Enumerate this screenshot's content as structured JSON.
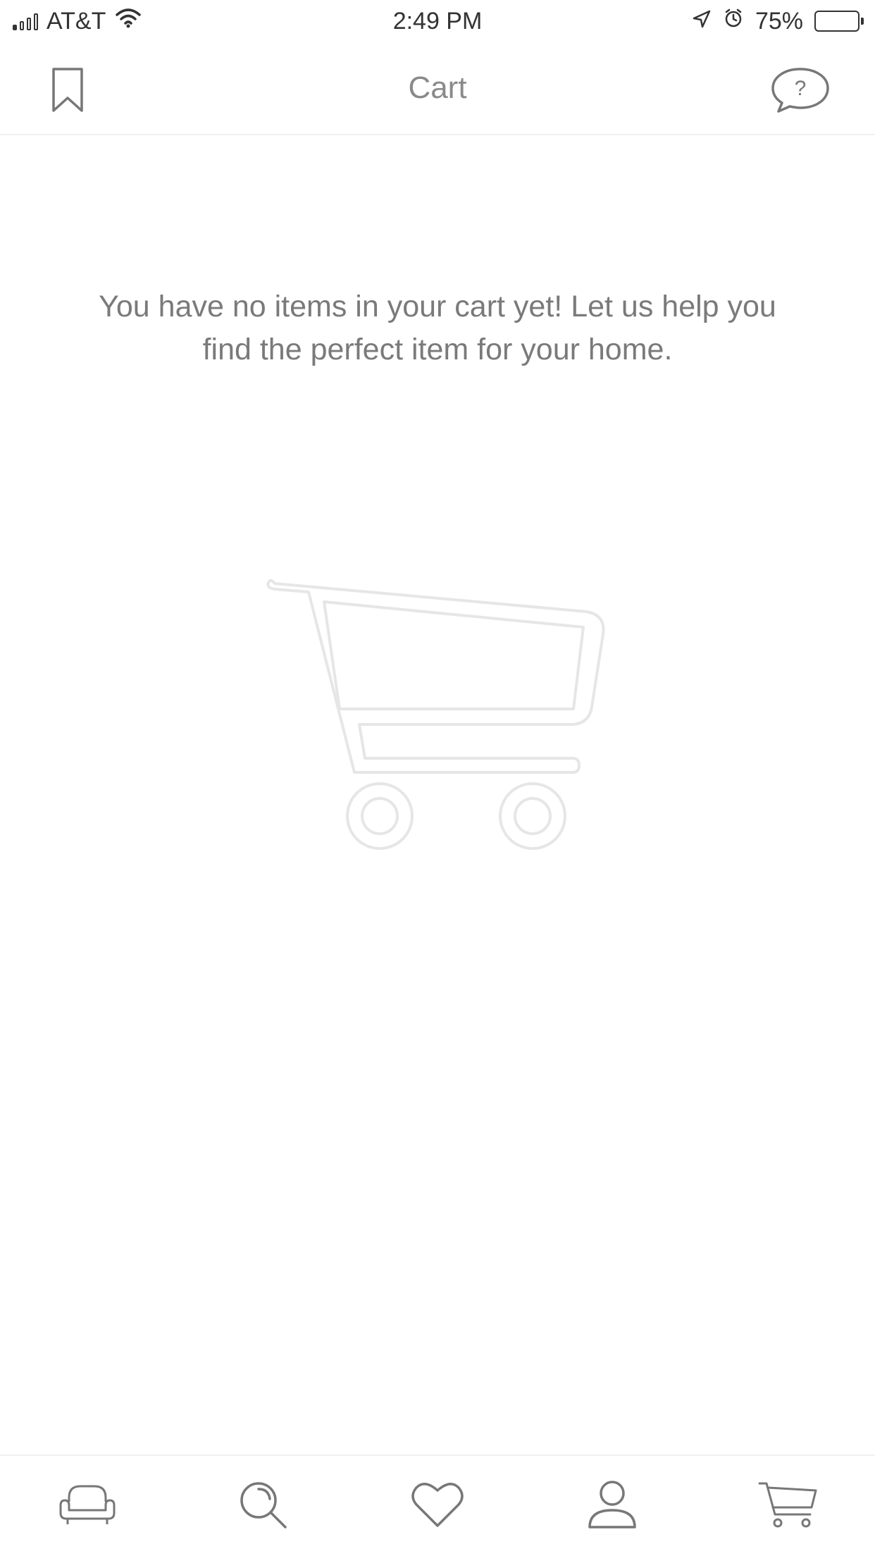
{
  "status_bar": {
    "carrier": "AT&T",
    "time": "2:49 PM",
    "battery_percent": "75%",
    "battery_level": 0.75,
    "icons": [
      "signal-icon",
      "wifi-icon",
      "location-icon",
      "alarm-icon",
      "battery-icon"
    ]
  },
  "header": {
    "title": "Cart",
    "left_icon": "bookmark-icon",
    "right_icon": "help-chat-icon",
    "help_glyph": "?"
  },
  "main": {
    "empty_message": "You have no items in your cart yet! Let us help you find the perfect item for your home.",
    "illustration": "cart-icon"
  },
  "tab_bar": {
    "tabs": [
      {
        "name": "home",
        "icon": "sofa-icon"
      },
      {
        "name": "search",
        "icon": "search-icon"
      },
      {
        "name": "favorites",
        "icon": "heart-icon"
      },
      {
        "name": "account",
        "icon": "profile-icon"
      },
      {
        "name": "cart",
        "icon": "cart-icon"
      }
    ]
  },
  "colors": {
    "text_primary": "#4a4a4a",
    "title": "#8a8a8a",
    "message": "#7a7a7a",
    "icon": "#777777",
    "illustration": "#e6e6e6",
    "divider": "#f0f0f0",
    "background": "#ffffff"
  }
}
